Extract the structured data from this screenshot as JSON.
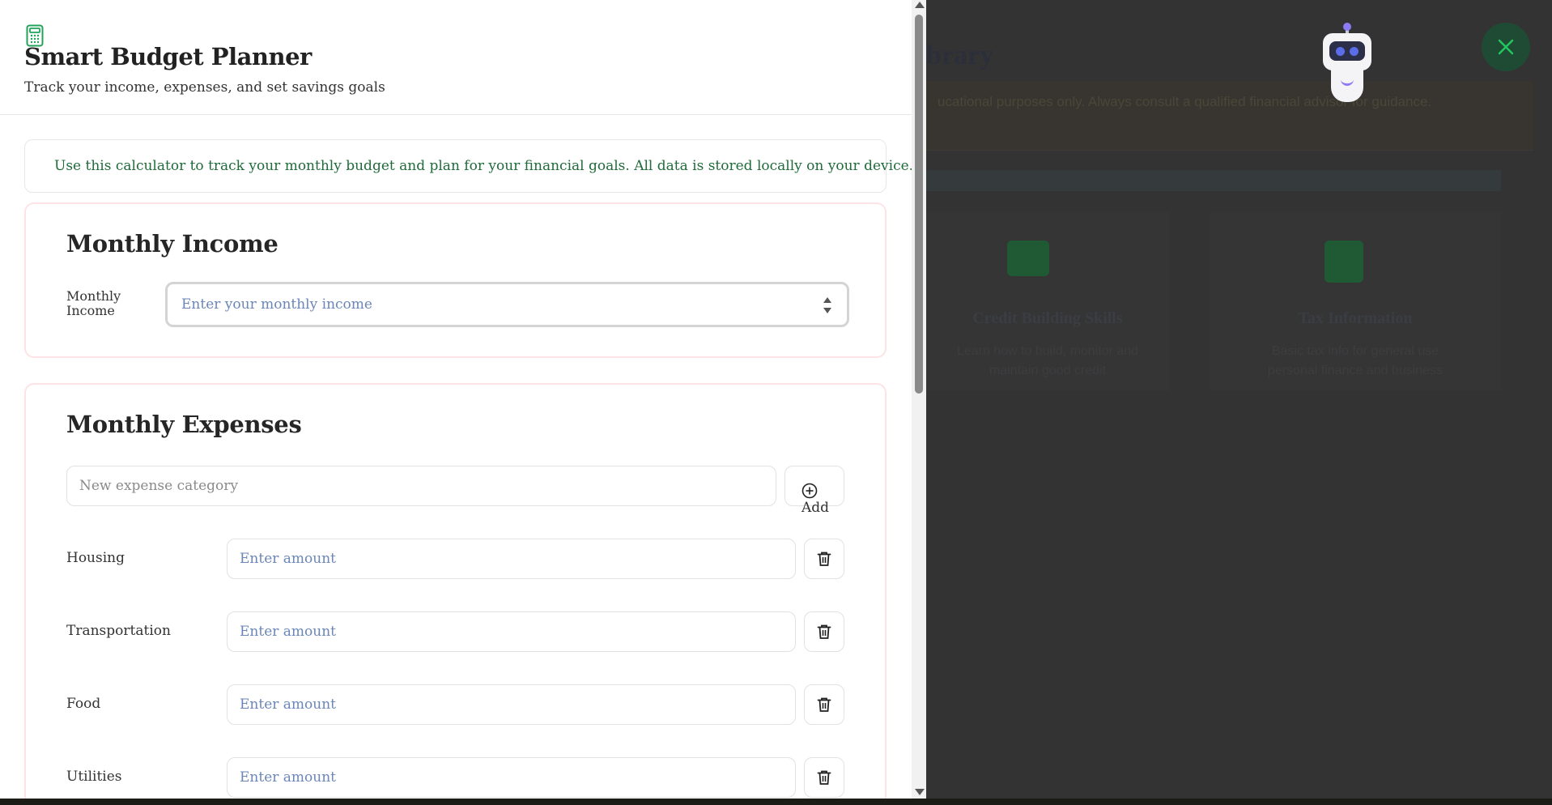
{
  "background": {
    "title": "brary",
    "banner_text": "ucational purposes only. Always consult a qualified financial advisor for guidance.",
    "cards": [
      {
        "title": "Credit Building Skills",
        "desc_line1": "Learn how to build, monitor and",
        "desc_line2": "maintain good credit"
      },
      {
        "title": "Tax Information",
        "desc_line1": "Basic tax info for general use",
        "desc_line2": "personal finance and business"
      }
    ]
  },
  "bot": {
    "icon": "robot-icon"
  },
  "close": {
    "icon": "close-icon",
    "color": "#22c55e"
  },
  "header": {
    "icon": "calculator-icon",
    "title": "Smart Budget Planner",
    "subtitle": "Track your income, expenses, and set savings goals"
  },
  "info": {
    "icon": "info-circle-icon",
    "text": "Use this calculator to track your monthly budget and plan for your financial goals. All data is stored locally on your device."
  },
  "income": {
    "title": "Monthly Income",
    "label": "Monthly Income",
    "placeholder": "Enter your monthly income",
    "value": ""
  },
  "expenses": {
    "title": "Monthly Expenses",
    "new_category_placeholder": "New expense category",
    "add_label": "Add",
    "add_icon": "plus-circle-icon",
    "delete_icon": "trash-icon",
    "items": [
      {
        "label": "Housing",
        "placeholder": "Enter amount"
      },
      {
        "label": "Transportation",
        "placeholder": "Enter amount"
      },
      {
        "label": "Food",
        "placeholder": "Enter amount"
      },
      {
        "label": "Utilities",
        "placeholder": "Enter amount"
      }
    ]
  },
  "colors": {
    "accent_green": "#22a35a",
    "info_text": "#1f6b3a",
    "card_border": "#fde3e6",
    "placeholder_blue": "#6b86b8"
  }
}
